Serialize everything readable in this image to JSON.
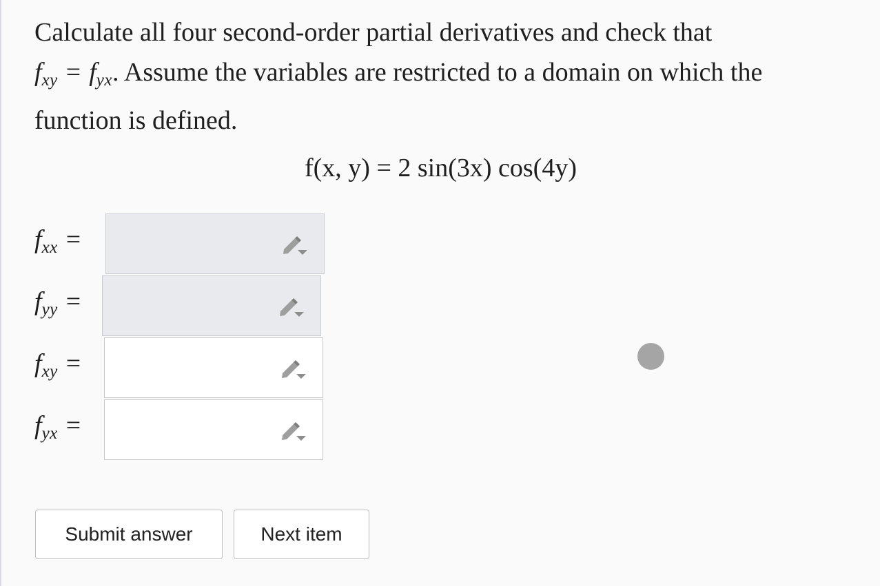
{
  "question": {
    "line1": "Calculate all four second-order partial derivatives and check that",
    "f1": "f",
    "sub1": "xy",
    "equals": "=",
    "f2": "f",
    "sub2": "yx",
    "line2_rest": ". Assume the variables are restricted to a domain on which the",
    "line3": "function is defined."
  },
  "function_display": "f(x, y) = 2 sin(3x) cos(4y)",
  "answers": [
    {
      "f": "f",
      "sub": "xx",
      "eq": "=",
      "value": ""
    },
    {
      "f": "f",
      "sub": "yy",
      "eq": "=",
      "value": ""
    },
    {
      "f": "f",
      "sub": "xy",
      "eq": "=",
      "value": ""
    },
    {
      "f": "f",
      "sub": "yx",
      "eq": "=",
      "value": ""
    }
  ],
  "icons": {
    "answer_editor": "pencil-dropdown-icon"
  },
  "buttons": {
    "submit": "Submit answer",
    "next": "Next item"
  },
  "colors": {
    "filled_box": "#e8eaed",
    "empty_box": "#ffffff",
    "cursor": "#a5a5a5"
  }
}
